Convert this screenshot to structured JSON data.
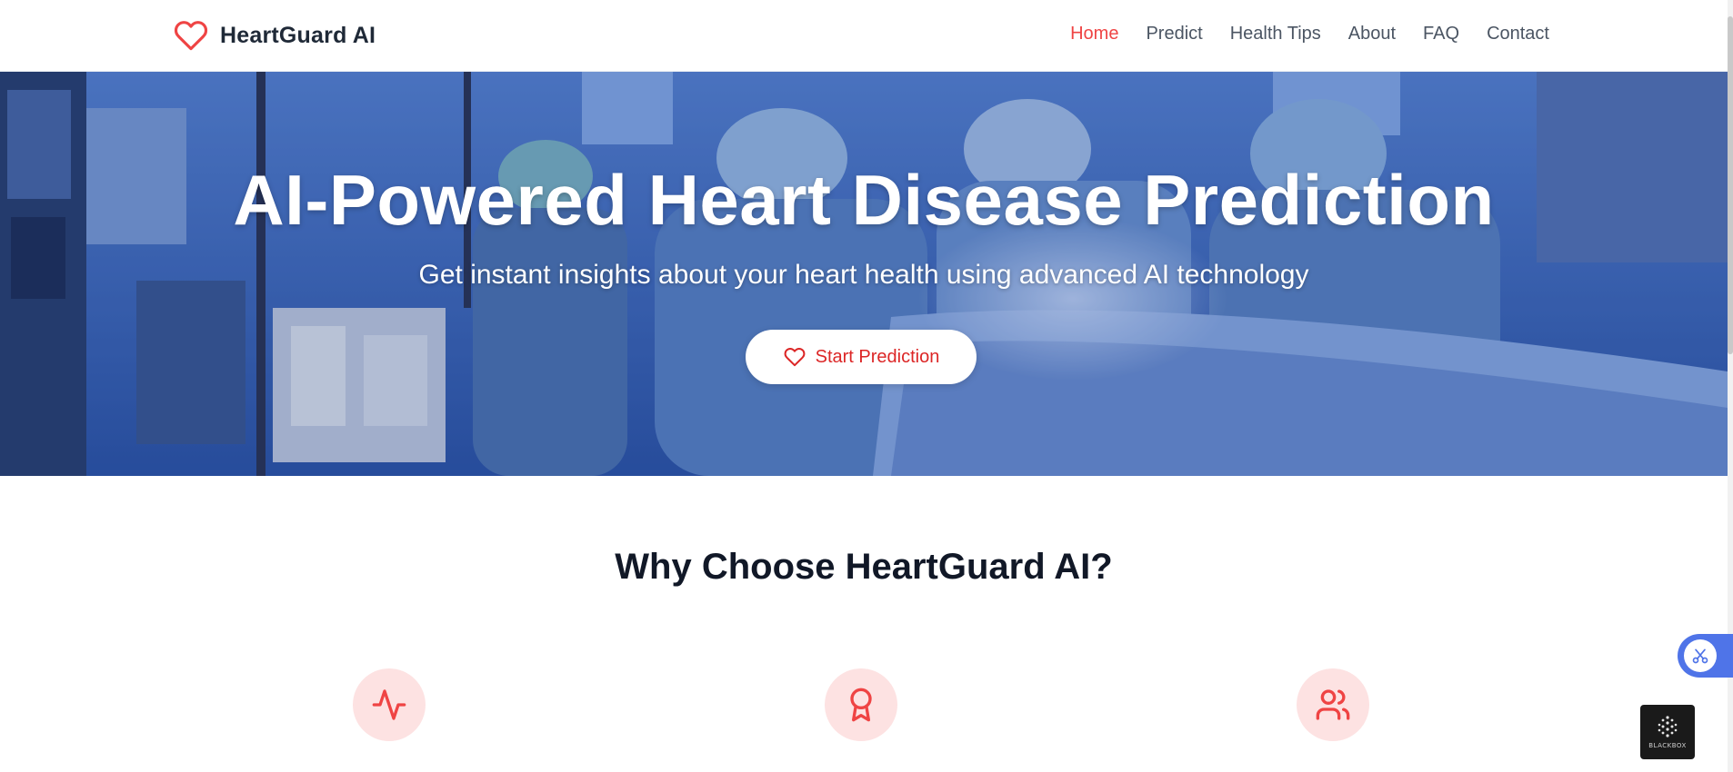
{
  "brand": {
    "name": "HeartGuard AI",
    "icon": "heart-outline-icon",
    "accent_color": "#ef4444"
  },
  "nav": {
    "items": [
      {
        "label": "Home",
        "active": true
      },
      {
        "label": "Predict",
        "active": false
      },
      {
        "label": "Health Tips",
        "active": false
      },
      {
        "label": "About",
        "active": false
      },
      {
        "label": "FAQ",
        "active": false
      },
      {
        "label": "Contact",
        "active": false
      }
    ]
  },
  "hero": {
    "title": "AI-Powered Heart Disease Prediction",
    "subtitle": "Get instant insights about your heart health using advanced AI technology",
    "cta_label": "Start Prediction",
    "cta_icon": "heart-outline-icon",
    "background": "operating-room-photo"
  },
  "features": {
    "title": "Why Choose HeartGuard AI?",
    "icons": [
      "activity-icon",
      "award-icon",
      "users-icon"
    ],
    "icon_bg_color": "#fde2e2",
    "icon_color": "#ef4444"
  },
  "widgets": {
    "scissors_icon": "scissors-icon",
    "blackbox_label": "BLACKBOX"
  }
}
